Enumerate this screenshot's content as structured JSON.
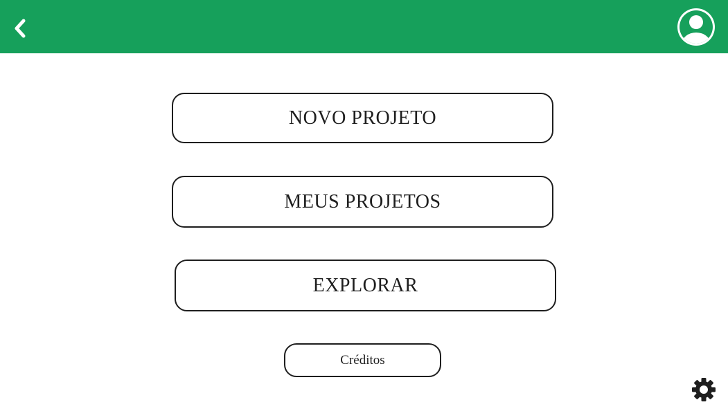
{
  "header": {
    "background_color": "#16a05b",
    "back_icon": "chevron-left-icon",
    "profile_icon": "user-avatar-icon"
  },
  "menu": {
    "new_project_label": "NOVO PROJETO",
    "my_projects_label": "MEUS PROJETOS",
    "explore_label": "EXPLORAR",
    "credits_label": "Créditos"
  },
  "footer": {
    "settings_icon": "gear-icon"
  }
}
